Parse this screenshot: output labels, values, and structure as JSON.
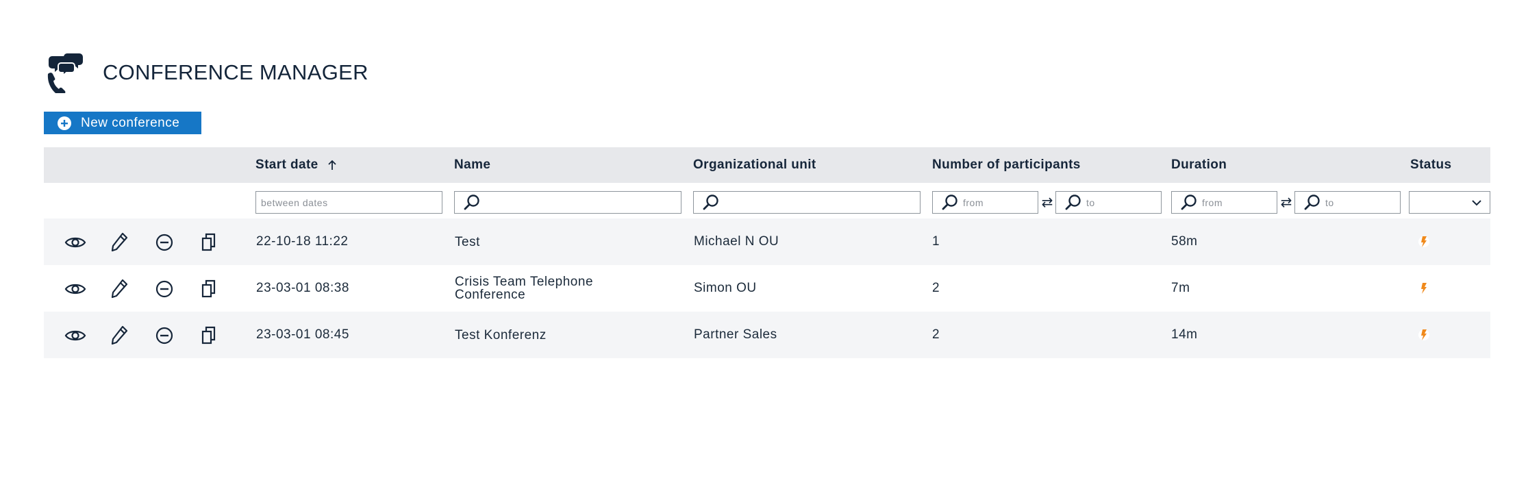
{
  "header": {
    "title": "CONFERENCE MANAGER",
    "icon": "phone-chat-icon"
  },
  "toolbar": {
    "new_conference_label": "New conference"
  },
  "columns": [
    {
      "key": "start_date",
      "label": "Start date",
      "sort": "ascending"
    },
    {
      "key": "name",
      "label": "Name"
    },
    {
      "key": "org_unit",
      "label": "Organizational unit"
    },
    {
      "key": "participants",
      "label": "Number of participants"
    },
    {
      "key": "duration",
      "label": "Duration"
    },
    {
      "key": "status",
      "label": "Status"
    }
  ],
  "filters": {
    "start_date_placeholder": "between dates",
    "name_value": "",
    "org_unit_value": "",
    "participants_from_placeholder": "from",
    "participants_to_placeholder": "to",
    "duration_from_placeholder": "from",
    "duration_to_placeholder": "to",
    "status_value": ""
  },
  "row_actions": [
    "view-eye-icon",
    "edit-pencil-icon",
    "delete-minus-icon",
    "copy-icon"
  ],
  "rows": [
    {
      "start_date": "22-10-18 11:22",
      "name": "Test",
      "org_unit": "Michael N OU",
      "participants": "1",
      "duration": "58m",
      "status_icon": "lightning-icon"
    },
    {
      "start_date": "23-03-01 08:38",
      "name": "Crisis Team Telephone Conference",
      "org_unit": "Simon OU",
      "participants": "2",
      "duration": "7m",
      "status_icon": "lightning-icon"
    },
    {
      "start_date": "23-03-01 08:45",
      "name": "Test Konferenz",
      "org_unit": "Partner Sales",
      "participants": "2",
      "duration": "14m",
      "status_icon": "lightning-icon"
    }
  ],
  "colors": {
    "accent": "#1677c6",
    "header_bg": "#e7e8eb",
    "alt_row_bg": "#f4f5f7",
    "status_orange": "#f08a1c",
    "text_dark": "#16263a"
  }
}
